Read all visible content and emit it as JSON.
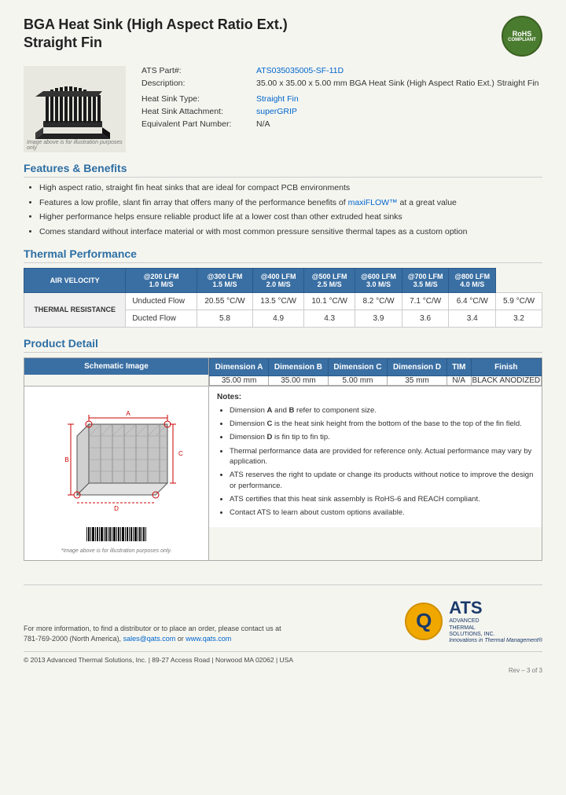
{
  "header": {
    "title_line1": "BGA Heat Sink (High Aspect Ratio Ext.)",
    "title_line2": "Straight Fin",
    "rohs": "RoHS\nCOMPLIANT"
  },
  "product": {
    "part_label": "ATS Part#:",
    "part_number": "ATS035035005-SF-11D",
    "description_label": "Description:",
    "description": "35.00 x 35.00 x 5.00 mm  BGA Heat Sink (High Aspect Ratio Ext.) Straight Fin",
    "heat_sink_type_label": "Heat Sink Type:",
    "heat_sink_type": "Straight Fin",
    "heat_sink_attachment_label": "Heat Sink Attachment:",
    "heat_sink_attachment": "superGRIP",
    "equiv_part_label": "Equivalent Part Number:",
    "equiv_part": "N/A"
  },
  "image_caption": "Image above is for illustration purposes only",
  "features": {
    "heading": "Features & Benefits",
    "items": [
      "High aspect ratio, straight fin heat sinks that are ideal for compact PCB environments",
      "Features a low profile, slant fin array that offers many of the performance benefits of maxiFLOW™ at a great value",
      "Higher performance helps ensure reliable product life at a lower cost than other extruded heat sinks",
      "Comes standard without interface material or with most common pressure sensitive thermal tapes as a custom option"
    ]
  },
  "thermal": {
    "heading": "Thermal Performance",
    "col_headers": [
      "AIR VELOCITY",
      "@200 LFM\n1.0 M/S",
      "@300 LFM\n1.5 M/S",
      "@400 LFM\n2.0 M/S",
      "@500 LFM\n2.5 M/S",
      "@600 LFM\n3.0 M/S",
      "@700 LFM\n3.5 M/S",
      "@800 LFM\n4.0 M/S"
    ],
    "row_label": "THERMAL RESISTANCE",
    "rows": [
      {
        "label": "Unducted Flow",
        "values": [
          "20.55 °C/W",
          "13.5 °C/W",
          "10.1 °C/W",
          "8.2 °C/W",
          "7.1 °C/W",
          "6.4 °C/W",
          "5.9 °C/W"
        ]
      },
      {
        "label": "Ducted Flow",
        "values": [
          "5.8",
          "4.9",
          "4.3",
          "3.9",
          "3.6",
          "3.4",
          "3.2"
        ]
      }
    ]
  },
  "product_detail": {
    "heading": "Product Detail",
    "schematic_label": "Schematic Image",
    "col_headers": [
      "Dimension A",
      "Dimension B",
      "Dimension C",
      "Dimension D",
      "TIM",
      "Finish"
    ],
    "dim_values": [
      "35.00 mm",
      "35.00 mm",
      "5.00 mm",
      "35 mm",
      "N/A",
      "BLACK ANODIZED"
    ],
    "notes_title": "Notes:",
    "notes": [
      "Dimension A and B refer to component size.",
      "Dimension C is the heat sink height from the bottom of the base to the top of the fin field.",
      "Dimension D is fin tip to fin tip.",
      "Thermal performance data are provided for reference only. Actual performance may vary by application.",
      "ATS reserves the right to update or change its products without notice to improve the design or performance.",
      "ATS certifies that this heat sink assembly is RoHS-6 and REACH compliant.",
      "Contact ATS to learn about custom options available."
    ],
    "schematic_caption": "*Image above is for illustration purposes only."
  },
  "footer": {
    "contact_text": "For more information, to find a distributor or to place an order, please contact us at",
    "phone": "781-769-2000 (North America),",
    "email": "sales@qats.com",
    "or": "or",
    "website": "www.qats.com",
    "copyright": "© 2013 Advanced Thermal Solutions, Inc.  |  89-27 Access Road  |  Norwood MA  02062  |  USA",
    "page_num": "Rev – 3 of 3",
    "ats_q": "Q",
    "ats_name": "ATS",
    "ats_full": "ADVANCED\nTHERMAL\nSOLUTIONS, INC.",
    "ats_tagline": "Innovations in Thermal Management®"
  }
}
